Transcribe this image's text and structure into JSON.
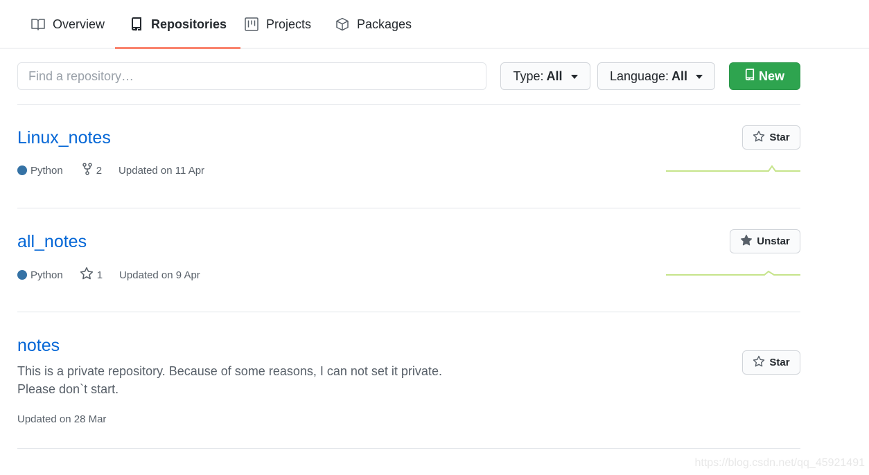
{
  "tabs": [
    {
      "label": "Overview",
      "icon": "book-icon",
      "selected": false
    },
    {
      "label": "Repositories",
      "icon": "repo-icon",
      "selected": true
    },
    {
      "label": "Projects",
      "icon": "project-icon",
      "selected": false
    },
    {
      "label": "Packages",
      "icon": "package-icon",
      "selected": false
    }
  ],
  "filters": {
    "search_placeholder": "Find a repository…",
    "type_label": "Type:",
    "type_value": "All",
    "language_label": "Language:",
    "language_value": "All",
    "new_label": "New"
  },
  "repos": [
    {
      "name": "Linux_notes",
      "language": "Python",
      "secondary_icon": "fork-icon",
      "secondary_count": "2",
      "updated": "Updated on 11 Apr",
      "star_label": "Star",
      "starred": false
    },
    {
      "name": "all_notes",
      "language": "Python",
      "secondary_icon": "star-icon",
      "secondary_count": "1",
      "updated": "Updated on 9 Apr",
      "star_label": "Unstar",
      "starred": true
    },
    {
      "name": "notes",
      "description_line1": "This is a private repository. Because of some reasons, I can not set it private.",
      "description_line2": "Please don`t start.",
      "updated": "Updated on 28 Mar",
      "star_label": "Star",
      "starred": false
    }
  ],
  "watermark": "https://blog.csdn.net/qq_45921491",
  "colors": {
    "link": "#0366d6",
    "python": "#3572A5",
    "new_button": "#2ea44f",
    "tab_underline": "#f9826c",
    "sparkline": "#c6e48b"
  }
}
